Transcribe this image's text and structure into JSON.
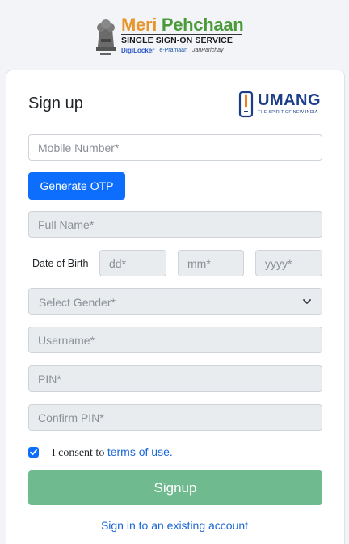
{
  "header": {
    "brand_meri": "Meri",
    "brand_pehchaan": "Pehchaan",
    "brand_subtitle": "SINGLE SIGN-ON SERVICE",
    "partner_digilocker": "DigiLocker",
    "partner_epramaan": "e-Pramaan",
    "partner_janparichay": "JanParichay"
  },
  "card": {
    "title": "Sign up",
    "partner_logo": "UMANG",
    "partner_tagline": "THE SPIRIT OF NEW INDIA"
  },
  "form": {
    "mobile_placeholder": "Mobile Number*",
    "otp_button": "Generate OTP",
    "fullname_placeholder": "Full Name*",
    "dob_label": "Date of Birth",
    "dd_placeholder": "dd*",
    "mm_placeholder": "mm*",
    "yyyy_placeholder": "yyyy*",
    "gender_placeholder": "Select Gender*",
    "username_placeholder": "Username*",
    "pin_placeholder": "PIN*",
    "confirm_pin_placeholder": "Confirm PIN*",
    "consent_prefix": "I consent to ",
    "consent_link": "terms of use.",
    "consent_checked": true,
    "signup_button": "Signup",
    "signin_link": "Sign in to an existing account"
  },
  "colors": {
    "primary": "#0d6efd",
    "signup_green": "#6fba8e",
    "link_blue": "#1c67d6",
    "umang_blue": "#1c3e8a",
    "umang_orange": "#f07a22"
  }
}
